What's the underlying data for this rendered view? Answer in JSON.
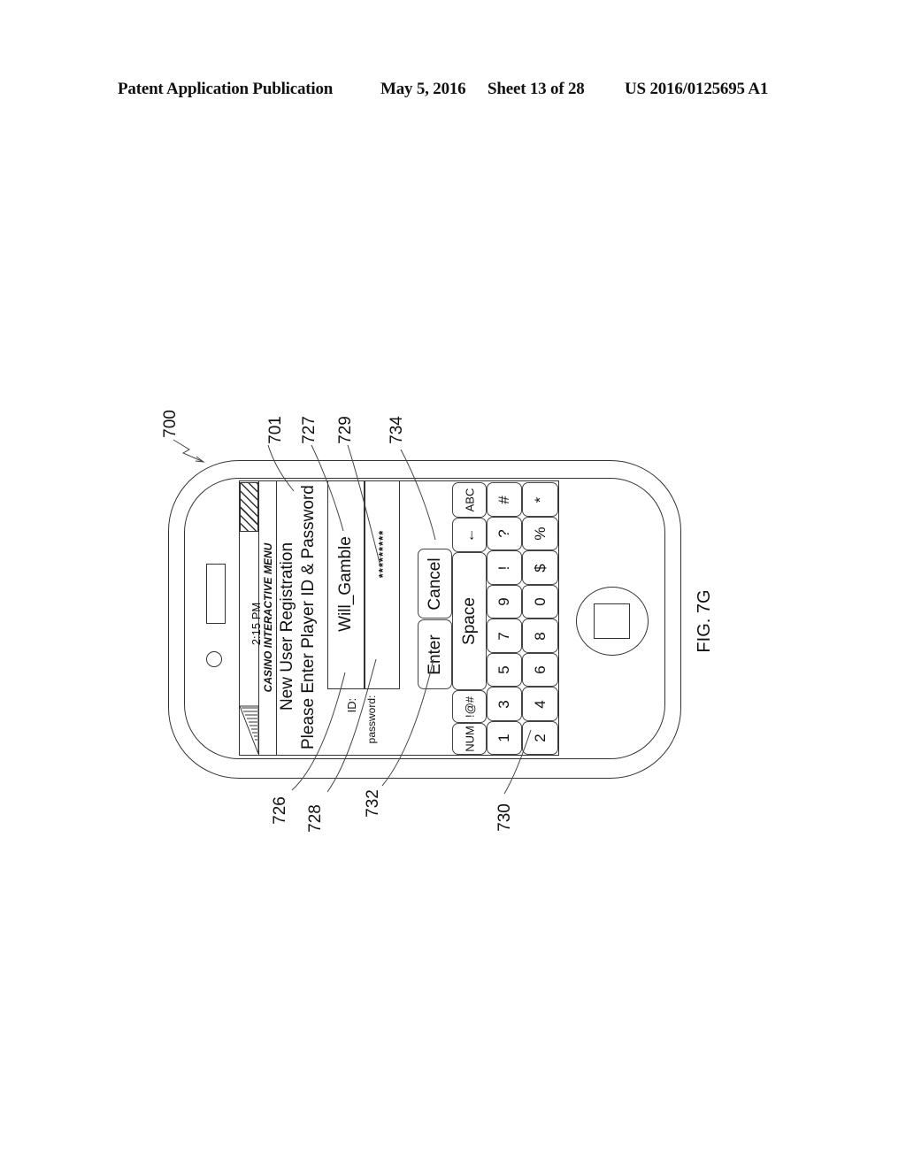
{
  "header": {
    "publication": "Patent Application Publication",
    "date": "May 5, 2016",
    "sheet": "Sheet 13 of 28",
    "number": "US 2016/0125695 A1"
  },
  "figure": {
    "caption": "FIG. 7G",
    "device_ref": "700",
    "screen": {
      "time": "2:15 PM",
      "menu_title": "CASINO INTERACTIVE MENU",
      "heading": "New User Registration",
      "instruction": "Please Enter Player ID & Password",
      "id_label": "ID:",
      "id_value": "Will_Gamble",
      "password_label": "password:",
      "password_value": "*********",
      "enter_button": "Enter",
      "cancel_button": "Cancel",
      "keyboard": {
        "row_mode": [
          "NUM",
          "!@#",
          "Space",
          "←",
          "ABC"
        ],
        "row_1": [
          "1",
          "3",
          "5",
          "7",
          "9",
          "!",
          "?",
          "#"
        ],
        "row_2": [
          "2",
          "4",
          "6",
          "8",
          "0",
          "$",
          "%",
          "*"
        ]
      }
    },
    "reference_numerals": {
      "r700": "700",
      "r701": "701",
      "r727": "727",
      "r729": "729",
      "r734": "734",
      "r726": "726",
      "r728": "728",
      "r732": "732",
      "r730": "730"
    }
  }
}
